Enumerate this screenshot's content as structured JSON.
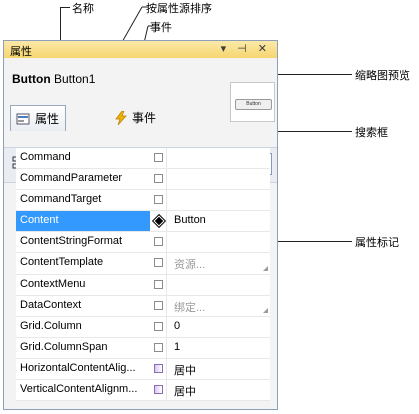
{
  "callouts": {
    "name": "名称",
    "sort_by_source": "按属性源排序",
    "events": "事件",
    "thumbnail": "缩略图预览",
    "search_box": "搜索框",
    "property_marker": "属性标记"
  },
  "panel": {
    "title": "属性",
    "controls": "▾ ⊣ ✕",
    "object_type": "Button",
    "object_name": "Button1",
    "thumbnail_button_text": "Button",
    "tabs": {
      "properties": "属性",
      "events": "事件"
    },
    "search": {
      "value": "Co"
    }
  },
  "properties": [
    {
      "name": "Command",
      "value": "",
      "marker": "default"
    },
    {
      "name": "CommandParameter",
      "value": "",
      "marker": "default"
    },
    {
      "name": "CommandTarget",
      "value": "",
      "marker": "default"
    },
    {
      "name": "Content",
      "value": "Button",
      "marker": "set",
      "selected": true
    },
    {
      "name": "ContentStringFormat",
      "value": "",
      "marker": "default"
    },
    {
      "name": "ContentTemplate",
      "value": "资源...",
      "marker": "default",
      "dim": true,
      "dropdown": true
    },
    {
      "name": "ContextMenu",
      "value": "",
      "marker": "default"
    },
    {
      "name": "DataContext",
      "value": "绑定...",
      "marker": "default",
      "dim": true,
      "dropdown": true
    },
    {
      "name": "Grid.Column",
      "value": "0",
      "marker": "default"
    },
    {
      "name": "Grid.ColumnSpan",
      "value": "1",
      "marker": "default"
    },
    {
      "name": "HorizontalContentAlig...",
      "value": "居中",
      "marker": "bind"
    },
    {
      "name": "VerticalContentAlignm...",
      "value": "居中",
      "marker": "bind"
    }
  ]
}
